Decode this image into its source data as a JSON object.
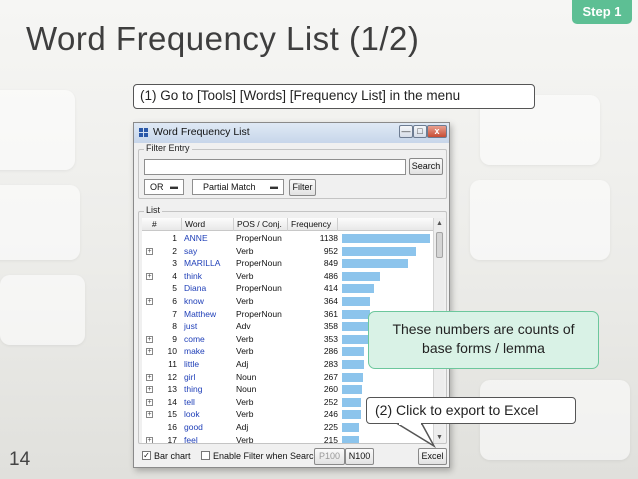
{
  "slide": {
    "title": "Word Frequency List (1/2)",
    "step_badge": "Step 1",
    "number": "14"
  },
  "callouts": {
    "menu_instruction": "(1) Go to [Tools] [Words] [Frequency List] in the menu",
    "counts_note_line1": "These numbers are counts of",
    "counts_note_line2": "base forms / lemma",
    "export_instruction": "(2) Click to export to Excel"
  },
  "colors": {
    "accent": "#5dbf94",
    "note_fill": "#d9f2e6",
    "bar_fill": "#8cc4ec",
    "word_link": "#1f3fb8"
  },
  "window": {
    "title": "Word Frequency List",
    "controls": {
      "minimize": "—",
      "maximize": "□",
      "close": "x"
    },
    "filter": {
      "group_label": "Filter Entry",
      "input_value": "",
      "search_label": "Search",
      "logic_value": "OR",
      "match_value": "Partial Match",
      "filter_label": "Filter"
    },
    "list": {
      "group_label": "List",
      "columns": [
        "#",
        "Word",
        "POS / Conj.",
        "Frequency"
      ],
      "rows": [
        {
          "n": "1",
          "expand": false,
          "word": "ANNE",
          "pos": "ProperNoun",
          "freq": 1138
        },
        {
          "n": "2",
          "expand": true,
          "word": "say",
          "pos": "Verb",
          "freq": 952
        },
        {
          "n": "3",
          "expand": false,
          "word": "MARILLA",
          "pos": "ProperNoun",
          "freq": 849
        },
        {
          "n": "4",
          "expand": true,
          "word": "think",
          "pos": "Verb",
          "freq": 486
        },
        {
          "n": "5",
          "expand": false,
          "word": "Diana",
          "pos": "ProperNoun",
          "freq": 414
        },
        {
          "n": "6",
          "expand": true,
          "word": "know",
          "pos": "Verb",
          "freq": 364
        },
        {
          "n": "7",
          "expand": false,
          "word": "Matthew",
          "pos": "ProperNoun",
          "freq": 361
        },
        {
          "n": "8",
          "expand": false,
          "word": "just",
          "pos": "Adv",
          "freq": 358
        },
        {
          "n": "9",
          "expand": true,
          "word": "come",
          "pos": "Verb",
          "freq": 353
        },
        {
          "n": "10",
          "expand": true,
          "word": "make",
          "pos": "Verb",
          "freq": 286
        },
        {
          "n": "11",
          "expand": false,
          "word": "little",
          "pos": "Adj",
          "freq": 283
        },
        {
          "n": "12",
          "expand": true,
          "word": "girl",
          "pos": "Noun",
          "freq": 267
        },
        {
          "n": "13",
          "expand": true,
          "word": "thing",
          "pos": "Noun",
          "freq": 260
        },
        {
          "n": "14",
          "expand": true,
          "word": "tell",
          "pos": "Verb",
          "freq": 252
        },
        {
          "n": "15",
          "expand": true,
          "word": "look",
          "pos": "Verb",
          "freq": 246
        },
        {
          "n": "16",
          "expand": false,
          "word": "good",
          "pos": "Adj",
          "freq": 225
        },
        {
          "n": "17",
          "expand": true,
          "word": "feel",
          "pos": "Verb",
          "freq": 215
        }
      ]
    },
    "bottom": {
      "bar_chart_checked": true,
      "bar_chart_label": "Bar chart",
      "enable_filter_checked": false,
      "enable_filter_label": "Enable Filter when Search",
      "p100_label": "P100",
      "n100_label": "N100",
      "excel_label": "Excel"
    }
  }
}
